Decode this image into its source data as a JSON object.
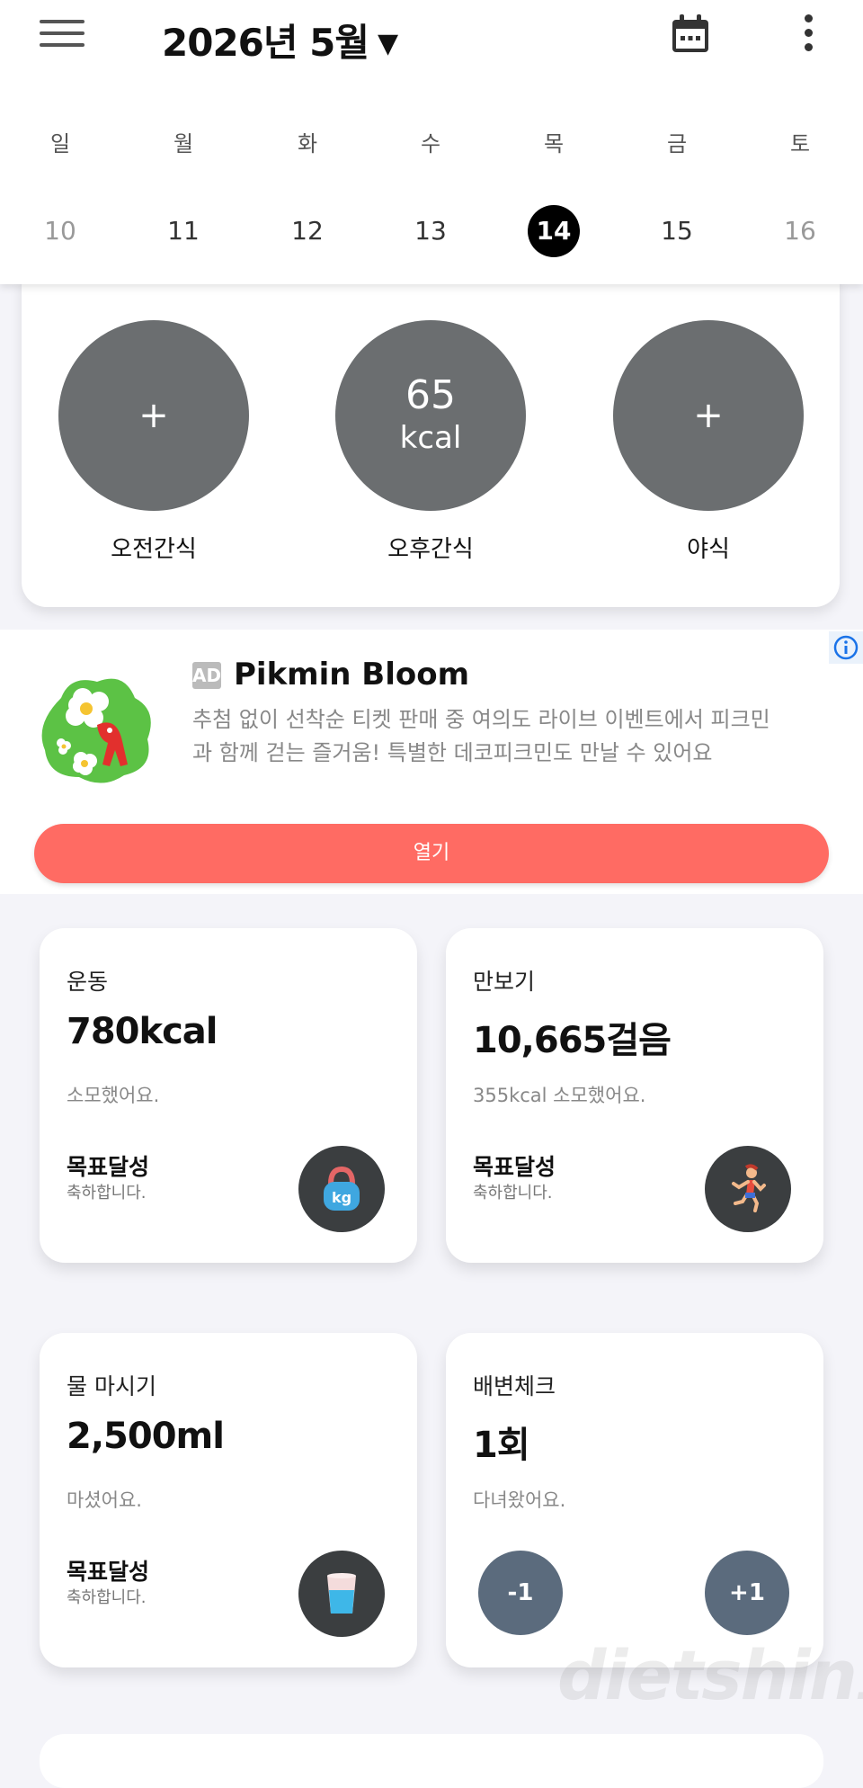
{
  "header": {
    "month_title": "2026년 5월",
    "dropdown_arrow": "▼",
    "weekdays": [
      "일",
      "월",
      "화",
      "수",
      "목",
      "금",
      "토"
    ],
    "days": [
      "10",
      "11",
      "12",
      "13",
      "14",
      "15",
      "16"
    ],
    "selected_day": "14"
  },
  "meals": [
    {
      "label": "오전간식",
      "value": "+",
      "unit": ""
    },
    {
      "label": "오후간식",
      "value": "65",
      "unit": "kcal"
    },
    {
      "label": "야식",
      "value": "+",
      "unit": ""
    }
  ],
  "ad": {
    "badge": "AD",
    "title": "Pikmin Bloom",
    "description": "추첨 없이 선착순 티켓 판매 중 여의도 라이브 이벤트에서 피크민과 함께 걷는 즐거움! 특별한 데코피크민도 만날 수 있어요",
    "open_label": "열기"
  },
  "exercise": {
    "title": "운동",
    "value": "780kcal",
    "sub": "소모했어요.",
    "goal": "목표달성",
    "goal_sub": "축하합니다.",
    "icon": "kettlebell-icon",
    "icon_text": "kg"
  },
  "steps": {
    "title": "만보기",
    "value": "10,665걸음",
    "sub": "355kcal 소모했어요.",
    "goal": "목표달성",
    "goal_sub": "축하합니다.",
    "icon": "runner-icon"
  },
  "water": {
    "title": "물 마시기",
    "value": "2,500ml",
    "sub": "마셨어요.",
    "goal": "목표달성",
    "goal_sub": "축하합니다.",
    "icon": "water-cup-icon"
  },
  "bowel": {
    "title": "배변체크",
    "value": "1회",
    "sub": "다녀왔어요.",
    "minus_label": "-1",
    "plus_label": "+1"
  },
  "watermark": {
    "brand": "dietshin",
    "suffix": ".com"
  },
  "colors": {
    "meal_circle": "#6b6e70",
    "ad_button": "#ff6b63",
    "stepper": "#5b6b7d",
    "icon_bg": "#3b3e40"
  }
}
